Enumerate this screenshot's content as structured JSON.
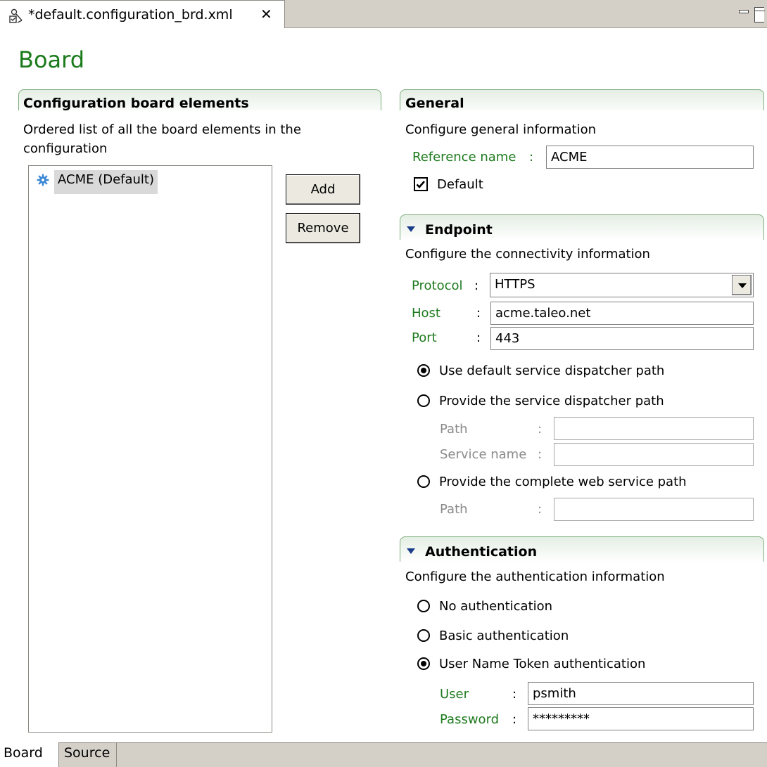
{
  "editor_tab": {
    "title": "*default.configuration_brd.xml",
    "close_glyph": "✕",
    "icon": "configuration-file-icon"
  },
  "page_title": "Board",
  "board_elements": {
    "title": "Configuration board elements",
    "description": "Ordered list of all the board elements in the configuration",
    "items": [
      {
        "label": "ACME (Default)",
        "icon": "gear-icon"
      }
    ],
    "add_label": "Add",
    "remove_label": "Remove"
  },
  "general": {
    "title": "General",
    "description": "Configure general information",
    "reference_name_label": "Reference name",
    "reference_name_value": "ACME",
    "default_label": "Default",
    "default_checked": true
  },
  "endpoint": {
    "title": "Endpoint",
    "description": "Configure the connectivity information",
    "protocol_label": "Protocol",
    "protocol_value": "HTTPS",
    "host_label": "Host",
    "host_value": "acme.taleo.net",
    "port_label": "Port",
    "port_value": "443",
    "radio_default_label": "Use default service dispatcher path",
    "radio_dispatcher_label": "Provide the service dispatcher path",
    "path_label": "Path",
    "path_value": "",
    "service_name_label": "Service name",
    "service_name_value": "",
    "radio_complete_label": "Provide the complete web service path",
    "complete_path_label": "Path",
    "complete_path_value": "",
    "selected": "default"
  },
  "authentication": {
    "title": "Authentication",
    "description": "Configure the authentication information",
    "radio_none_label": "No authentication",
    "radio_basic_label": "Basic authentication",
    "radio_token_label": "User Name Token authentication",
    "selected": "token",
    "user_label": "User",
    "user_value": "psmith",
    "password_label": "Password",
    "password_value": "*********"
  },
  "colon": ":",
  "bottom_tabs": {
    "board": "Board",
    "source": "Source"
  },
  "colors": {
    "accent_green": "#1e7a1e",
    "title_green": "#1a7a1a",
    "section_border": "#7dad7d",
    "chrome": "#d4d0c8"
  }
}
